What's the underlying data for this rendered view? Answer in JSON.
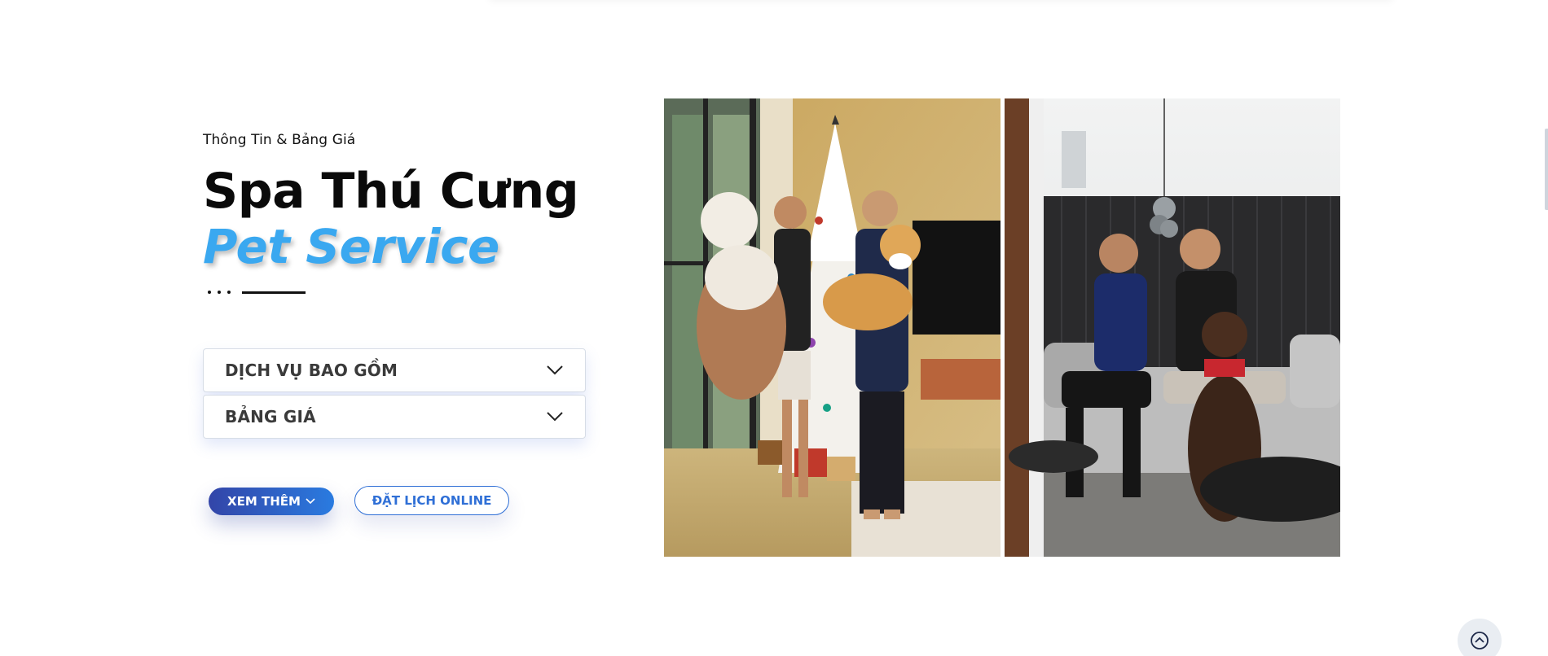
{
  "section": {
    "subtitle": "Thông Tin & Bảng Giá",
    "title": "Spa Thú Cưng",
    "title_accent": "Pet Service"
  },
  "accordion": [
    {
      "label": "DỊCH VỤ BAO GỒM",
      "icon": "chevron-down-icon"
    },
    {
      "label": "BẢNG GIÁ",
      "icon": "chevron-down-icon"
    }
  ],
  "buttons": {
    "see_more": "XEM THÊM",
    "book_online": "ĐẶT LỊCH ONLINE"
  },
  "photos": [
    {
      "icon": "photo-christmas-tree-dogs"
    },
    {
      "icon": "photo-living-room-labrador"
    }
  ],
  "colors": {
    "accent": "#3aa8f0",
    "button_gradient_start": "#3345a8",
    "button_gradient_end": "#2a7be0",
    "outline": "#2f6fd6"
  },
  "scroll_top": {
    "icon": "chevron-up-circle-icon"
  }
}
